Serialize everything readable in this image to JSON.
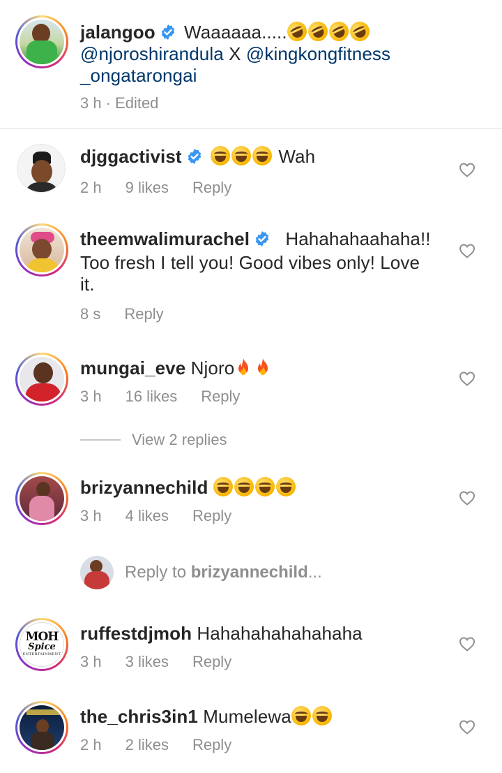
{
  "caption": {
    "username": "jalangoo",
    "text": "Waaaaaa.....",
    "mention1": "@njoroshirandula",
    "separator": "X",
    "mention2": "@kingkongfitness",
    "mention2_cont": "_ongatarongai",
    "time": "3 h",
    "edited": "· Edited",
    "emoji": "rolling-on-floor-laughing x4"
  },
  "comments": [
    {
      "username": "djggactivist",
      "text": "Wah",
      "time": "2 h",
      "likes": "9 likes",
      "reply": "Reply",
      "emoji": "grinning-squinting x3"
    },
    {
      "username": "theemwalimurachel",
      "text1": "Hahahahaahaha!!",
      "text2": "Too fresh I tell you! Good vibes only! Love",
      "text3": "it.",
      "time": "8 s",
      "reply": "Reply"
    },
    {
      "username": "mungai_eve",
      "text": "Njoro",
      "time": "3 h",
      "likes": "16 likes",
      "reply": "Reply",
      "emoji": "fire x2"
    },
    {
      "username": "brizyannechild",
      "time": "3 h",
      "likes": "4 likes",
      "reply": "Reply",
      "emoji": "grinning-squinting x4"
    },
    {
      "username": "ruffestdjmoh",
      "text": "Hahahahahahahaha",
      "time": "3 h",
      "likes": "3 likes",
      "reply": "Reply"
    },
    {
      "username": "the_chris3in1",
      "text": "Mumelewa",
      "time": "2 h",
      "likes": "2 likes",
      "reply": "Reply",
      "emoji": "grinning-squinting x2"
    }
  ],
  "view_replies": "View 2 replies",
  "reply_to": {
    "prefix": "Reply to",
    "username": "brizyannechild",
    "suffix": "..."
  },
  "avatar_logo": {
    "line1": "MOH",
    "line2": "Spice",
    "line3": "ENTERTAINMENT"
  },
  "colors": {
    "accent_mention": "#00376b",
    "verified": "#3897f0",
    "meta": "#8e8e8e"
  }
}
